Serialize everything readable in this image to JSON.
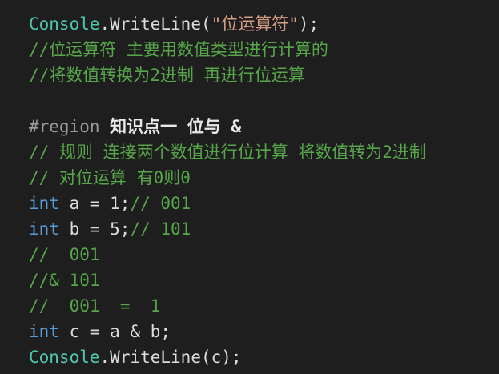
{
  "code": {
    "l1": {
      "cls": "Console",
      "dot": ".",
      "method": "WriteLine(",
      "str": "\"位运算符\"",
      "end": ");"
    },
    "l2": "//位运算符 主要用数值类型进行计算的",
    "l3": "//将数值转换为2进制 再进行位运算",
    "l5": {
      "pre": "#region",
      "label": " 知识点一 位与 &"
    },
    "l6": "// 规则 连接两个数值进行位计算 将数值转为2进制",
    "l7": "// 对位运算 有0则0",
    "l8": {
      "kw": "int",
      "code": " a = 1;",
      "cm": "// 001"
    },
    "l9": {
      "kw": "int",
      "code": " b = 5;",
      "cm": "// 101"
    },
    "l10": "//  001",
    "l11": "//& 101",
    "l12": "//  001  =  1",
    "l13": {
      "kw": "int",
      "code": " c = a & b;"
    },
    "l14": {
      "cls": "Console",
      "dot": ".",
      "method": "WriteLine(c);"
    }
  },
  "colors": {
    "background": "#1e1e1e",
    "keyword": "#569cd6",
    "class": "#4ec9b0",
    "string": "#d69d85",
    "comment": "#57a64a",
    "preprocessor": "#9b9b9b",
    "text": "#dcdcdc"
  }
}
